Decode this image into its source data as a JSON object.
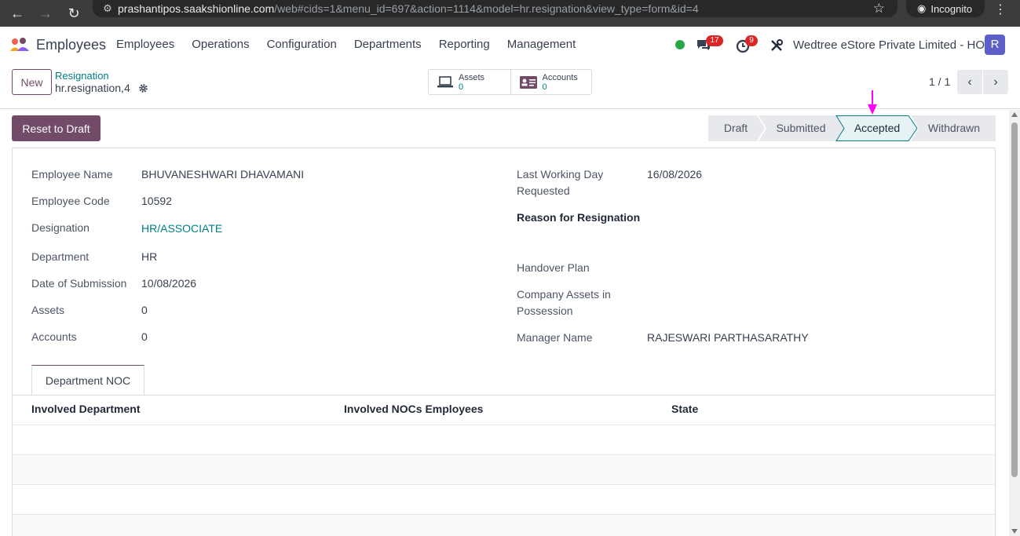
{
  "browser": {
    "url_host": "prashantipos.saakshionline.com",
    "url_path": "/web#cids=1&menu_id=697&action=1114&model=hr.resignation&view_type=form&id=4",
    "incognito_label": "Incognito"
  },
  "navbar": {
    "app_name": "Employees",
    "menus": [
      "Employees",
      "Operations",
      "Configuration",
      "Departments",
      "Reporting",
      "Management"
    ],
    "chat_badge": "17",
    "activity_badge": "9",
    "company": "Wedtree eStore Private Limited - HO",
    "avatar_letter": "R"
  },
  "control_panel": {
    "new_label": "New",
    "breadcrumb_parent": "Resignation",
    "breadcrumb_current": "hr.resignation,4",
    "stats": [
      {
        "label": "Assets",
        "value": "0"
      },
      {
        "label": "Accounts",
        "value": "0"
      }
    ],
    "pager": "1 / 1"
  },
  "header": {
    "reset_label": "Reset to Draft",
    "stages": [
      "Draft",
      "Submitted",
      "Accepted",
      "Withdrawn"
    ],
    "active_stage": "Accepted"
  },
  "form": {
    "left": [
      {
        "label": "Employee Name",
        "value": "BHUVANESHWARI DHAVAMANI"
      },
      {
        "label": "Employee Code",
        "value": "10592"
      },
      {
        "label": "Designation",
        "value": "HR/ASSOCIATE"
      },
      {
        "label": "Department",
        "value": "HR"
      },
      {
        "label": "Date of Submission",
        "value": "10/08/2026"
      },
      {
        "label": "Assets",
        "value": "0"
      },
      {
        "label": "Accounts",
        "value": "0"
      }
    ],
    "right": {
      "last_working_day_label_1": "Last Working Day",
      "last_working_day_label_2": "Requested",
      "last_working_day_value": "16/08/2026",
      "reason_label": "Reason for Resignation",
      "handover_label": "Handover Plan",
      "company_assets_label_1": "Company Assets in",
      "company_assets_label_2": "Possession",
      "manager_label": "Manager Name",
      "manager_value": "RAJESWARI PARTHASARATHY"
    }
  },
  "notebook": {
    "tab_label": "Department NOC",
    "columns": [
      "Involved Department",
      "Involved NOCs Employees",
      "State"
    ]
  },
  "colors": {
    "brand": "#714b67",
    "link": "#017e84",
    "active_stage_bg": "#e6f2f3",
    "annotation_arrow": "#ff00ff"
  }
}
